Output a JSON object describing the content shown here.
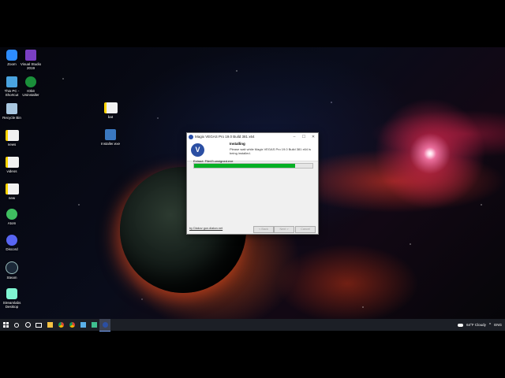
{
  "desktop": {
    "icons": [
      {
        "name": "zoom",
        "label": "Zoom"
      },
      {
        "name": "visual-studio",
        "label": "Visual Studio 2019"
      },
      {
        "name": "this-pc",
        "label": "This PC - Shortcut"
      },
      {
        "name": "utorrent",
        "label": "IObit Uninstaller"
      },
      {
        "name": "recycle-bin",
        "label": "Recycle Bin"
      },
      {
        "name": "news",
        "label": "news"
      },
      {
        "name": "videos",
        "label": "videos"
      },
      {
        "name": "new",
        "label": "new"
      },
      {
        "name": "atom",
        "label": "Atom"
      },
      {
        "name": "discord",
        "label": "Discord"
      },
      {
        "name": "steam",
        "label": "Steam"
      },
      {
        "name": "streamlabs",
        "label": "Streamlabs Desktop"
      },
      {
        "name": "bat",
        "label": "bat"
      },
      {
        "name": "installer",
        "label": "Installer.exe"
      }
    ]
  },
  "dialog": {
    "title": "Magix VEGAS Pro 19.0 Build 381 x64",
    "logo_letter": "V",
    "heading": "Installing",
    "description": "Please wait while Magix VEGAS Pro 19.0 Build 381 x64 is being installed.",
    "status": "Extract: File43.unsigned.exe",
    "progress": 0.85,
    "brand_link": "by Diakov gon.diakov.net",
    "buttons": {
      "back": "< Back",
      "next": "Next >",
      "cancel": "Cancel"
    },
    "minimize": "–",
    "maximize": "☐",
    "close": "✕"
  },
  "taskbar": {
    "weather": "64°F  Cloudy",
    "language": "ENG",
    "tray_chevron": "^"
  },
  "colors": {
    "progress": "#06b025",
    "vegas_blue": "#2b4fa3"
  }
}
